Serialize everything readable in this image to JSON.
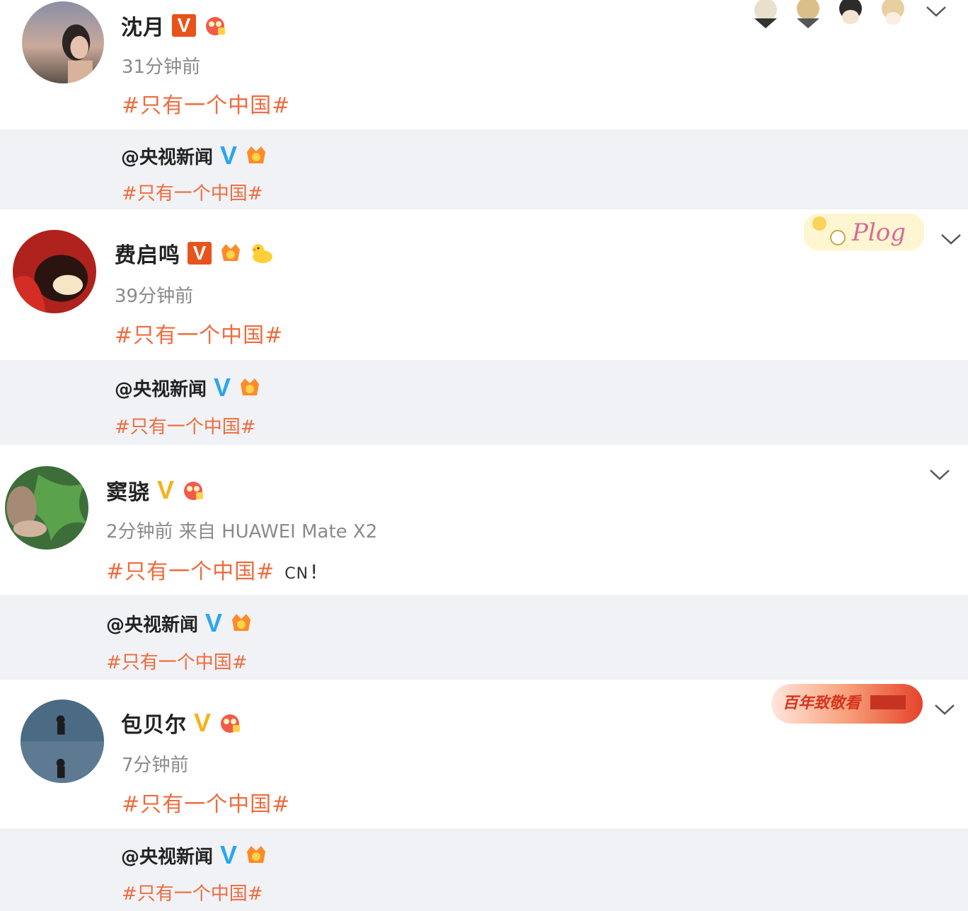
{
  "posts": [
    {
      "name": "沈月",
      "time": "31分钟前",
      "topic": "#只有一个中国#",
      "quote": {
        "author": "@央视新闻",
        "topic": "#只有一个中国#"
      }
    },
    {
      "name": "费启鸣",
      "time": "39分钟前",
      "topic": "#只有一个中国#",
      "quote": {
        "author": "@央视新闻",
        "topic": "#只有一个中国#"
      }
    },
    {
      "name": "窦骁",
      "time": "2分钟前 来自 HUAWEI Mate X2",
      "topic": "#只有一个中国#",
      "topic_extra": "CN",
      "topic_bang": "!",
      "quote": {
        "author": "@央视新闻",
        "topic": "#只有一个中国#"
      }
    },
    {
      "name": "包贝尔",
      "time": "7分钟前",
      "topic": "#只有一个中国#",
      "quote": {
        "author": "@央视新闻",
        "topic": "#只有一个中国#"
      }
    }
  ],
  "verify_letter": "V",
  "decor": {
    "plog_text": "Plog",
    "banner_text": "百年致敬看"
  },
  "colors": {
    "topic": "#ef6b3d",
    "quote_bg": "#f1f2f5",
    "verified_red": "#e8531b",
    "verified_gold": "#f6b11c",
    "verified_blue": "#2aa5f2"
  },
  "icons": [
    "more-chevron-icon",
    "verified-icon",
    "membership-badge-icon",
    "crown-badge-icon",
    "duck-badge-icon"
  ]
}
